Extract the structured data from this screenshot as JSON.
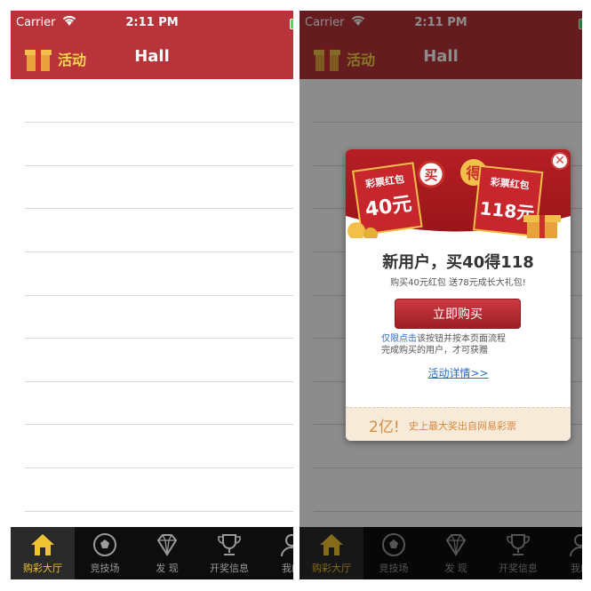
{
  "status": {
    "carrier": "Carrier",
    "time": "2:11 PM"
  },
  "nav": {
    "activity_label": "活动",
    "title": "Hall"
  },
  "tabs": [
    {
      "label": "购彩大厅",
      "icon": "home-icon",
      "active": true
    },
    {
      "label": "竞技场",
      "icon": "soccer-ball-icon",
      "active": false
    },
    {
      "label": "发 现",
      "icon": "diamond-icon",
      "active": false
    },
    {
      "label": "开奖信息",
      "icon": "trophy-icon",
      "active": false
    },
    {
      "label": "我的",
      "icon": "user-icon",
      "active": false
    }
  ],
  "popup": {
    "left_card_label": "彩票红包",
    "left_card_amount": "40元",
    "buy_badge": "买",
    "get_badge": "得",
    "right_card_label": "彩票红包",
    "right_card_amount": "118元",
    "headline": "新用户，买40得118",
    "subline": "购买40元红包 送78元成长大礼包!",
    "buy_button": "立即购买",
    "note_highlight": "仅限点击",
    "note_line1": "该按钮并按本页面流程",
    "note_line2": "完成购买的用户，才可获赠",
    "details_link": "活动详情>>",
    "footer_amount": "2亿!",
    "footer_slogan": "史上最大奖出自网易彩票",
    "close_label": "✕"
  },
  "colors": {
    "nav_red": "#b8343a",
    "accent_gold": "#f1c232",
    "link_blue": "#2a6cc9"
  }
}
